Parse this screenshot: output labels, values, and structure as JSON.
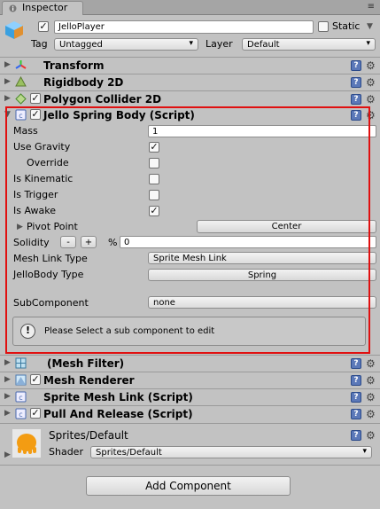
{
  "window": {
    "tab": "Inspector",
    "tab_menu": "≡"
  },
  "gameobject": {
    "active": true,
    "name": "JelloPlayer",
    "static_label": "Static",
    "static_checked": false,
    "tag_label": "Tag",
    "tag_value": "Untagged",
    "layer_label": "Layer",
    "layer_value": "Default"
  },
  "components": {
    "transform": "Transform",
    "rigidbody": "Rigidbody 2D",
    "polygon": "Polygon Collider 2D",
    "jello": "Jello Spring Body (Script)",
    "meshfilter": "(Mesh Filter)",
    "meshrenderer": "Mesh Renderer",
    "spritemeshlink": "Sprite Mesh Link (Script)",
    "pullrelease": "Pull And Release (Script)"
  },
  "jello": {
    "mass_label": "Mass",
    "mass_value": "1",
    "use_gravity_label": "Use Gravity",
    "use_gravity": true,
    "override_label": "Override",
    "override": false,
    "is_kinematic_label": "Is Kinematic",
    "is_kinematic": false,
    "is_trigger_label": "Is Trigger",
    "is_trigger": false,
    "is_awake_label": "Is Awake",
    "is_awake": true,
    "pivot_label": "Pivot Point",
    "pivot_value": "Center",
    "solidity_label": "Solidity",
    "minus": "-",
    "plus": "+",
    "percent": "%",
    "solidity_value": "0",
    "mesh_link_label": "Mesh Link Type",
    "mesh_link_value": "Sprite Mesh Link",
    "jellobody_label": "JelloBody Type",
    "jellobody_value": "Spring",
    "subcomponent_label": "SubComponent",
    "subcomponent_value": "none",
    "info_text": "Please Select a sub component to edit",
    "info_symbol": "!"
  },
  "material": {
    "name": "Sprites/Default",
    "shader_label": "Shader",
    "shader_value": "Sprites/Default"
  },
  "add_component": "Add Component",
  "colors": {
    "highlight": "#e01010",
    "help_icon": "#5b78b8",
    "material_icon": "#f39c12"
  }
}
